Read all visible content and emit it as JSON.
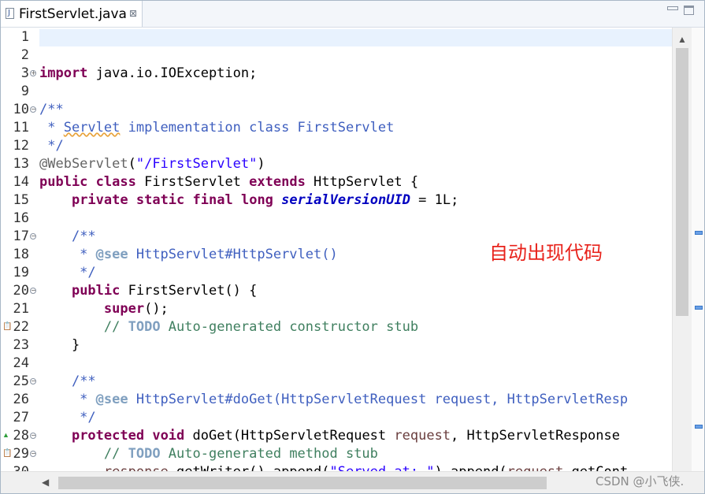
{
  "tab": {
    "title": "FirstServlet.java",
    "close": "⊠"
  },
  "overlay_label": "自动出现代码",
  "watermark": "CSDN @小飞侠.",
  "scroll": {
    "up_arrow": "▲",
    "left_arrow": "◀"
  },
  "lines": [
    {
      "n": "1",
      "html": ""
    },
    {
      "n": "2",
      "html": ""
    },
    {
      "n": "3",
      "fold": "+",
      "html": "<span class=\"k\">import</span> java.io.IOException;"
    },
    {
      "n": "9",
      "html": ""
    },
    {
      "n": "10",
      "fold": "-",
      "html": "<span class=\"d\">/**</span>"
    },
    {
      "n": "11",
      "html": "<span class=\"d\"> * <span class=\"squig\">Servlet</span> implementation class FirstServlet</span>"
    },
    {
      "n": "12",
      "html": "<span class=\"d\"> */</span>"
    },
    {
      "n": "13",
      "html": "<span class=\"ann\">@WebServlet</span>(<span class=\"str\">\"/FirstServlet\"</span>)"
    },
    {
      "n": "14",
      "html": "<span class=\"k\">public</span> <span class=\"k\">class</span> FirstServlet <span class=\"k\">extends</span> HttpServlet {"
    },
    {
      "n": "15",
      "html": "    <span class=\"k\">private</span> <span class=\"k\">static</span> <span class=\"k\">final</span> <span class=\"k\">long</span> <span class=\"fld\">serialVersionUID</span> = 1L;"
    },
    {
      "n": "16",
      "html": ""
    },
    {
      "n": "17",
      "fold": "-",
      "html": "    <span class=\"d\">/**</span>"
    },
    {
      "n": "18",
      "html": "<span class=\"d\">     * <b style=\"color:#7f9fbf\">@see</b> HttpServlet#HttpServlet()</span>"
    },
    {
      "n": "19",
      "html": "<span class=\"d\">     */</span>"
    },
    {
      "n": "20",
      "fold": "-",
      "html": "    <span class=\"k\">public</span> FirstServlet() {"
    },
    {
      "n": "21",
      "html": "        <span class=\"k\">super</span>();"
    },
    {
      "n": "22",
      "marker": "task",
      "html": "        <span class=\"c\">// <span class=\"todo\">TODO</span> Auto-generated constructor stub</span>"
    },
    {
      "n": "23",
      "html": "    }"
    },
    {
      "n": "24",
      "html": ""
    },
    {
      "n": "25",
      "fold": "-",
      "html": "    <span class=\"d\">/**</span>"
    },
    {
      "n": "26",
      "html": "<span class=\"d\">     * <b style=\"color:#7f9fbf\">@see</b> HttpServlet#doGet(HttpServletRequest request, HttpServletResp</span>"
    },
    {
      "n": "27",
      "html": "<span class=\"d\">     */</span>"
    },
    {
      "n": "28",
      "fold": "-",
      "marker": "override",
      "html": "    <span class=\"k\">protected</span> <span class=\"k\">void</span> doGet(HttpServletRequest <span class=\"par\">request</span>, HttpServletResponse"
    },
    {
      "n": "29",
      "fold": "-",
      "marker": "task",
      "html": "        <span class=\"c\">// <span class=\"todo\">TODO</span> Auto-generated method stub</span>"
    },
    {
      "n": "30",
      "html": "        <span class=\"par\">response</span>.getWriter().append(<span class=\"str\">\"Served at: \"</span>).append(<span class=\"par\">request</span>.getCont"
    }
  ]
}
